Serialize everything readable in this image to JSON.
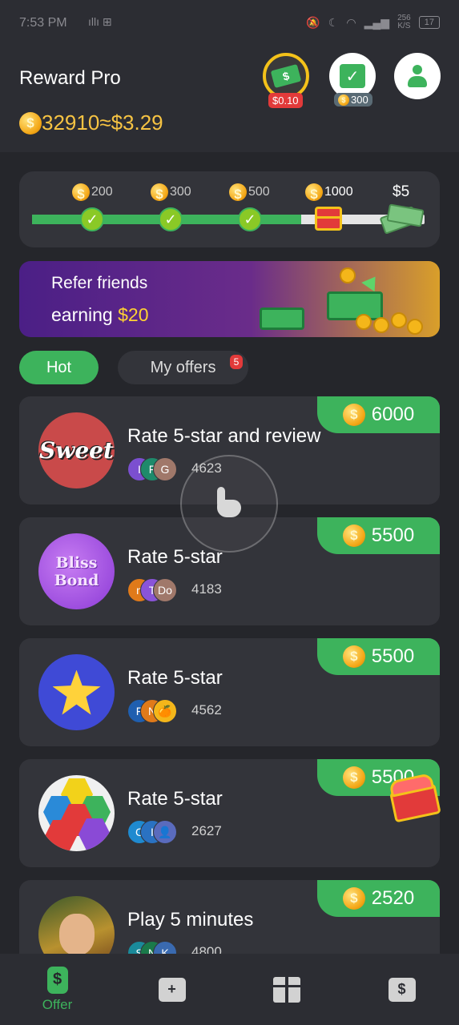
{
  "status_bar": {
    "time": "7:53 PM",
    "signal_text": "ıllı ⊞",
    "speed_top": "256",
    "speed_unit": "K/S",
    "battery": "17"
  },
  "header": {
    "app_title": "Reward Pro",
    "coin_balance": "32910",
    "cash_equivalent": "≈$3.29",
    "cash_button_badge": "$0.10",
    "checkin_badge": "300"
  },
  "progress": {
    "milestones": [
      {
        "label": "200",
        "reached": true
      },
      {
        "label": "300",
        "reached": true
      },
      {
        "label": "500",
        "reached": true
      },
      {
        "label": "1000",
        "reached": false,
        "current": true
      },
      {
        "label": "$5",
        "reached": false
      }
    ],
    "fill_fraction": 0.685
  },
  "refer_banner": {
    "line1": "Refer friends",
    "line2_prefix": "earning ",
    "line2_amount": "$20"
  },
  "tabs": [
    {
      "label": "Hot",
      "active": true
    },
    {
      "label": "My offers",
      "active": false,
      "badge": "5"
    }
  ],
  "offers": [
    {
      "title": "Rate 5-star and review",
      "reward": "6000",
      "count": "4623",
      "icon": "sweet-app-icon",
      "icon_text": "Sweet",
      "avatars": [
        "I",
        "F",
        "G"
      ],
      "avatar_colors": [
        "#7b4fd0",
        "#1f8a6b",
        "#a0786a"
      ]
    },
    {
      "title": "Rate 5-star",
      "reward": "5500",
      "count": "4183",
      "icon": "bliss-bond-app-icon",
      "icon_text": "Bliss Bond",
      "avatars": [
        "n",
        "T",
        "Do"
      ],
      "avatar_colors": [
        "#e07a1a",
        "#8a54d8",
        "#a0786a"
      ]
    },
    {
      "title": "Rate 5-star",
      "reward": "5500",
      "count": "4562",
      "icon": "star-claw-app-icon",
      "icon_text": "",
      "avatars": [
        "F",
        "N",
        "🍊"
      ],
      "avatar_colors": [
        "#1f5fb0",
        "#e07a1a",
        "#f4b61a"
      ]
    },
    {
      "title": "Rate 5-star",
      "reward": "5500",
      "count": "2627",
      "icon": "hexa-sort-app-icon",
      "icon_text": "",
      "avatars": [
        "C",
        "I",
        "👤"
      ],
      "avatar_colors": [
        "#1f8ad0",
        "#2a72c2",
        "#5a6bbd"
      ]
    },
    {
      "title": "Play 5 minutes",
      "reward": "2520",
      "count": "4800",
      "icon": "hero-game-app-icon",
      "icon_text": "",
      "avatars": [
        "S",
        "N",
        "K"
      ],
      "avatar_colors": [
        "#1a8a9a",
        "#1a7a4a",
        "#3a6ab0"
      ]
    }
  ],
  "bottom_nav": [
    {
      "label": "Offer",
      "active": true,
      "icon": "offer-wallet-icon"
    },
    {
      "label": "",
      "active": false,
      "icon": "inbox-add-icon"
    },
    {
      "label": "",
      "active": false,
      "icon": "gift-icon"
    },
    {
      "label": "",
      "active": false,
      "icon": "cash-card-icon"
    }
  ],
  "colors": {
    "accent": "#3db35c",
    "gold": "#f6c343",
    "badge_red": "#e23a3a",
    "card": "#33343a",
    "bg": "#25262b"
  }
}
